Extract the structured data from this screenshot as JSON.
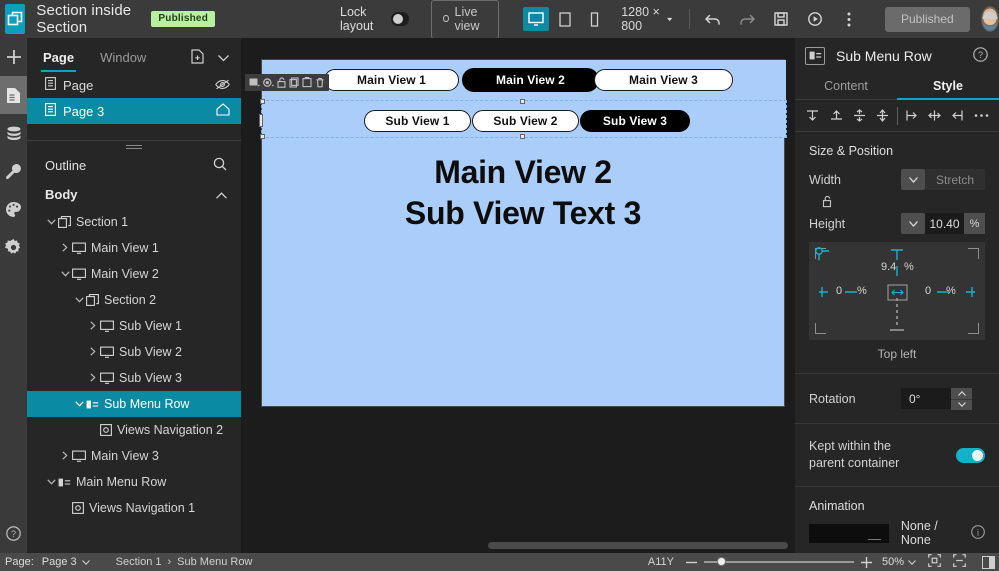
{
  "topbar": {
    "logo_icon": "app-logo-icon",
    "app_title": "Section inside Section",
    "published_badge": "Published",
    "lock_layout_label": "Lock layout",
    "live_view_label": "Live view",
    "device_desktop_icon": "desktop-icon",
    "device_tablet_icon": "tablet-icon",
    "device_phone_icon": "phone-icon",
    "canvas_size": "1280 × 800",
    "undo_icon": "undo-icon",
    "redo_icon": "redo-icon",
    "save_icon": "save-icon",
    "preview_icon": "play-icon",
    "more_icon": "more-vertical-icon",
    "publish_button": "Published",
    "avatar": "user-avatar"
  },
  "rail": {
    "items": [
      {
        "icon": "plus-icon",
        "name": "add"
      },
      {
        "icon": "pages-icon",
        "name": "pages",
        "active": true
      },
      {
        "icon": "database-icon",
        "name": "data"
      },
      {
        "icon": "wrench-icon",
        "name": "tools"
      },
      {
        "icon": "palette-icon",
        "name": "theme"
      },
      {
        "icon": "gear-icon",
        "name": "settings"
      }
    ],
    "help_icon": "help-icon"
  },
  "left_panel": {
    "tabs": [
      {
        "label": "Page",
        "active": true
      },
      {
        "label": "Window",
        "active": false
      }
    ],
    "add_page_icon": "add-page-icon",
    "collapse_icon": "chevron-down-icon",
    "pages": [
      {
        "label": "Page",
        "icon": "page-icon",
        "tail_icon": "eye-off-icon",
        "selected": false
      },
      {
        "label": "Page 3",
        "icon": "page-icon",
        "tail_icon": "home-icon",
        "selected": true
      }
    ],
    "outline_title": "Outline",
    "outline_search_icon": "search-icon",
    "body_title": "Body",
    "body_collapse_icon": "chevron-up-icon",
    "tree": [
      {
        "label": "Section 1",
        "indent": 0,
        "caret": "down",
        "icon": "section-icon",
        "selected": false
      },
      {
        "label": "Main View 1",
        "indent": 1,
        "caret": "right",
        "icon": "view-icon",
        "selected": false
      },
      {
        "label": "Main View 2",
        "indent": 1,
        "caret": "down",
        "icon": "view-icon",
        "selected": false
      },
      {
        "label": "Section 2",
        "indent": 2,
        "caret": "down",
        "icon": "section-icon",
        "selected": false
      },
      {
        "label": "Sub View 1",
        "indent": 3,
        "caret": "right",
        "icon": "view-icon",
        "selected": false
      },
      {
        "label": "Sub View 2",
        "indent": 3,
        "caret": "right",
        "icon": "view-icon",
        "selected": false
      },
      {
        "label": "Sub View 3",
        "indent": 3,
        "caret": "right",
        "icon": "view-icon",
        "selected": false
      },
      {
        "label": "Sub Menu Row",
        "indent": 2,
        "caret": "down",
        "icon": "menurow-icon",
        "selected": true
      },
      {
        "label": "Views Navigation 2",
        "indent": 3,
        "caret": "none",
        "icon": "navigation-icon",
        "selected": false
      },
      {
        "label": "Main View 3",
        "indent": 1,
        "caret": "right",
        "icon": "view-icon",
        "selected": false
      },
      {
        "label": "Main Menu Row",
        "indent": 0,
        "caret": "down",
        "icon": "menurow-icon",
        "selected": false
      },
      {
        "label": "Views Navigation 1",
        "indent": 1,
        "caret": "none",
        "icon": "navigation-icon",
        "selected": false
      }
    ]
  },
  "canvas": {
    "background_color": "#aacdf9",
    "float_toolbar": [
      {
        "icon": "image-fill-icon",
        "name": "image-fill"
      },
      {
        "icon": "color-fill-icon",
        "name": "color-fill"
      },
      {
        "icon": "unlock-icon",
        "name": "unlock"
      },
      {
        "icon": "copy-icon",
        "name": "copy"
      },
      {
        "icon": "paste-icon",
        "name": "paste"
      },
      {
        "icon": "trash-icon",
        "name": "delete"
      }
    ],
    "main_tabs": [
      {
        "label": "Main View 1",
        "active": false
      },
      {
        "label": "Main View 2",
        "active": true
      },
      {
        "label": "Main View 3",
        "active": false
      }
    ],
    "sub_tabs": [
      {
        "label": "Sub View 1",
        "active": false
      },
      {
        "label": "Sub View 2",
        "active": false
      },
      {
        "label": "Sub View 3",
        "active": true
      }
    ],
    "content_line1": "Main View 2",
    "content_line2": "Sub View Text 3"
  },
  "right_panel": {
    "element_icon": "menurow-icon",
    "element_title": "Sub Menu Row",
    "help_icon": "help-circle-icon",
    "tabs": [
      {
        "label": "Content",
        "active": false
      },
      {
        "label": "Style",
        "active": true
      }
    ],
    "align_icons": [
      "align-top-icon",
      "align-middle-icon",
      "align-bottom-icon",
      "align-stretch-icon",
      "align-left-icon",
      "align-center-icon",
      "align-right-icon",
      "more-align-icon"
    ],
    "size_position_title": "Size & Position",
    "width_label": "Width",
    "width_value": "Stretch",
    "lock_icon": "unlock-icon",
    "height_label": "Height",
    "height_value": "10.40",
    "height_unit": "%",
    "position": {
      "top_value": "9.4",
      "top_unit": "%",
      "left_value": "0",
      "left_unit": "%",
      "right_value": "0",
      "right_unit": "%",
      "anchor_label": "Top left",
      "accent_color": "#15b4cc"
    },
    "rotation_label": "Rotation",
    "rotation_value": "0°",
    "kept_within_label": "Kept within the parent container",
    "kept_within_on": true,
    "animation_title": "Animation",
    "animation_value": "None / None",
    "animation_info_icon": "info-icon"
  },
  "status_bar": {
    "page_label": "Page:",
    "page_value": "Page 3",
    "breadcrumb": [
      "Section 1",
      "Sub Menu Row"
    ],
    "a11y_label": "A11Y",
    "zoom_value": "50%",
    "fit_icon": "fit-screen-icon",
    "fit_width_icon": "fit-width-icon",
    "panel_icon": "toggle-panel-icon"
  }
}
